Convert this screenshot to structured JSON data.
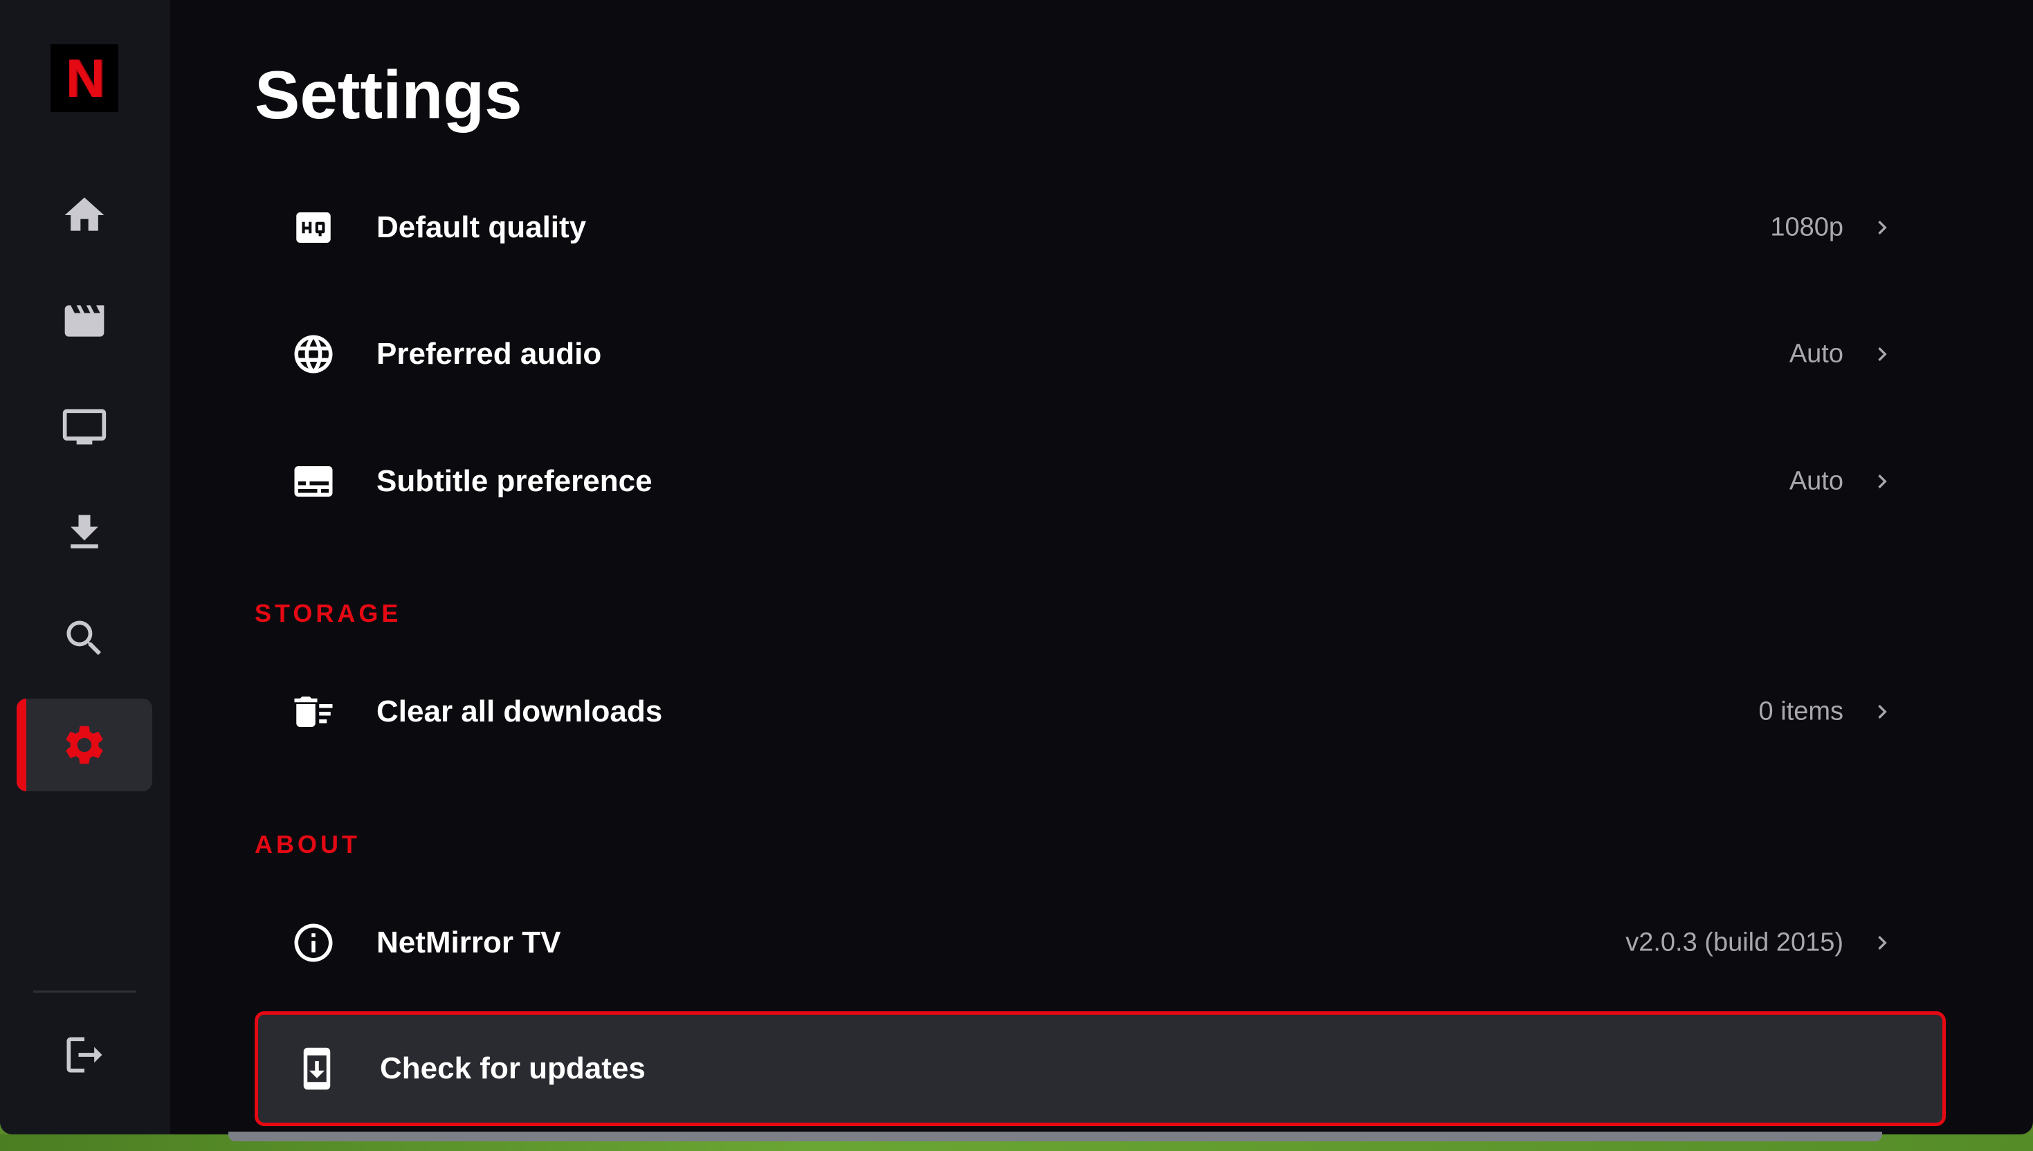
{
  "app": {
    "logo_letter": "N",
    "brand_color": "#e50914"
  },
  "sidebar": {
    "items": [
      {
        "name": "home",
        "icon": "home-icon"
      },
      {
        "name": "movies",
        "icon": "clapperboard-icon"
      },
      {
        "name": "tv",
        "icon": "tv-icon"
      },
      {
        "name": "downloads",
        "icon": "download-icon"
      },
      {
        "name": "search",
        "icon": "search-icon"
      },
      {
        "name": "settings",
        "icon": "gear-icon",
        "active": true
      }
    ],
    "bottom": {
      "name": "logout",
      "icon": "logout-icon"
    }
  },
  "page": {
    "title": "Settings"
  },
  "playback": {
    "rows": [
      {
        "label": "Default quality",
        "value": "1080p",
        "icon": "hq-icon"
      },
      {
        "label": "Preferred audio",
        "value": "Auto",
        "icon": "globe-icon"
      },
      {
        "label": "Subtitle preference",
        "value": "Auto",
        "icon": "subtitles-icon"
      }
    ]
  },
  "storage": {
    "header": "STORAGE",
    "rows": [
      {
        "label": "Clear all downloads",
        "value": "0 items",
        "icon": "delete-sweep-icon"
      }
    ]
  },
  "about": {
    "header": "ABOUT",
    "rows": [
      {
        "label": "NetMirror TV",
        "value": "v2.0.3 (build 2015)",
        "icon": "info-icon"
      },
      {
        "label": "Check for updates",
        "value": "",
        "icon": "system-update-icon",
        "focused": true
      }
    ]
  }
}
